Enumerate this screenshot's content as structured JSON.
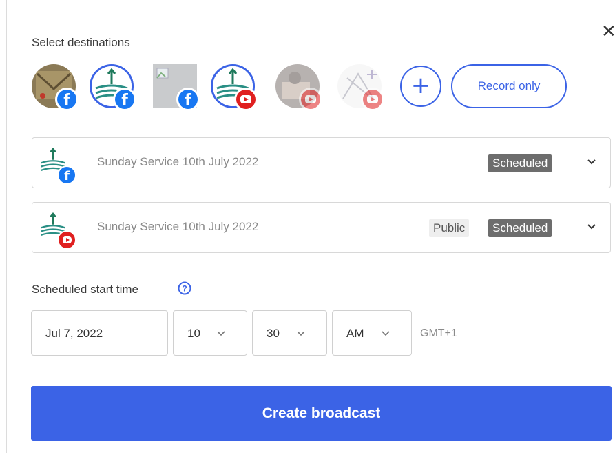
{
  "dialog": {
    "close_glyph": "✕",
    "destinations_label": "Select destinations",
    "destinations": [
      {
        "name": "destination-1",
        "platform": "facebook",
        "selected": false,
        "dim": false
      },
      {
        "name": "destination-2",
        "platform": "facebook",
        "selected": true,
        "dim": false
      },
      {
        "name": "destination-3",
        "platform": "facebook",
        "selected": false,
        "dim": false
      },
      {
        "name": "destination-4",
        "platform": "youtube",
        "selected": true,
        "dim": false
      },
      {
        "name": "destination-5",
        "platform": "youtube",
        "selected": false,
        "dim": true
      },
      {
        "name": "destination-6",
        "platform": "youtube",
        "selected": false,
        "dim": true
      }
    ],
    "add_glyph": "+",
    "record_only_label": "Record only"
  },
  "broadcasts": [
    {
      "platform": "facebook",
      "title": "Sunday Service 10th July 2022",
      "privacy": "",
      "status": "Scheduled"
    },
    {
      "platform": "youtube",
      "title": "Sunday Service 10th July 2022",
      "privacy": "Public",
      "status": "Scheduled"
    }
  ],
  "schedule": {
    "label": "Scheduled start time",
    "date": "Jul 7, 2022",
    "hour": "10",
    "minute": "30",
    "ampm": "AM",
    "timezone": "GMT+1"
  },
  "create_button_label": "Create broadcast",
  "colors": {
    "accent": "#3b63e6",
    "facebook": "#1877f2",
    "youtube": "#e02020",
    "status_badge": "#6d6d6d"
  },
  "icons": [
    "close-icon",
    "facebook-icon",
    "youtube-icon",
    "plus-icon",
    "chevron-down-icon",
    "help-icon"
  ]
}
